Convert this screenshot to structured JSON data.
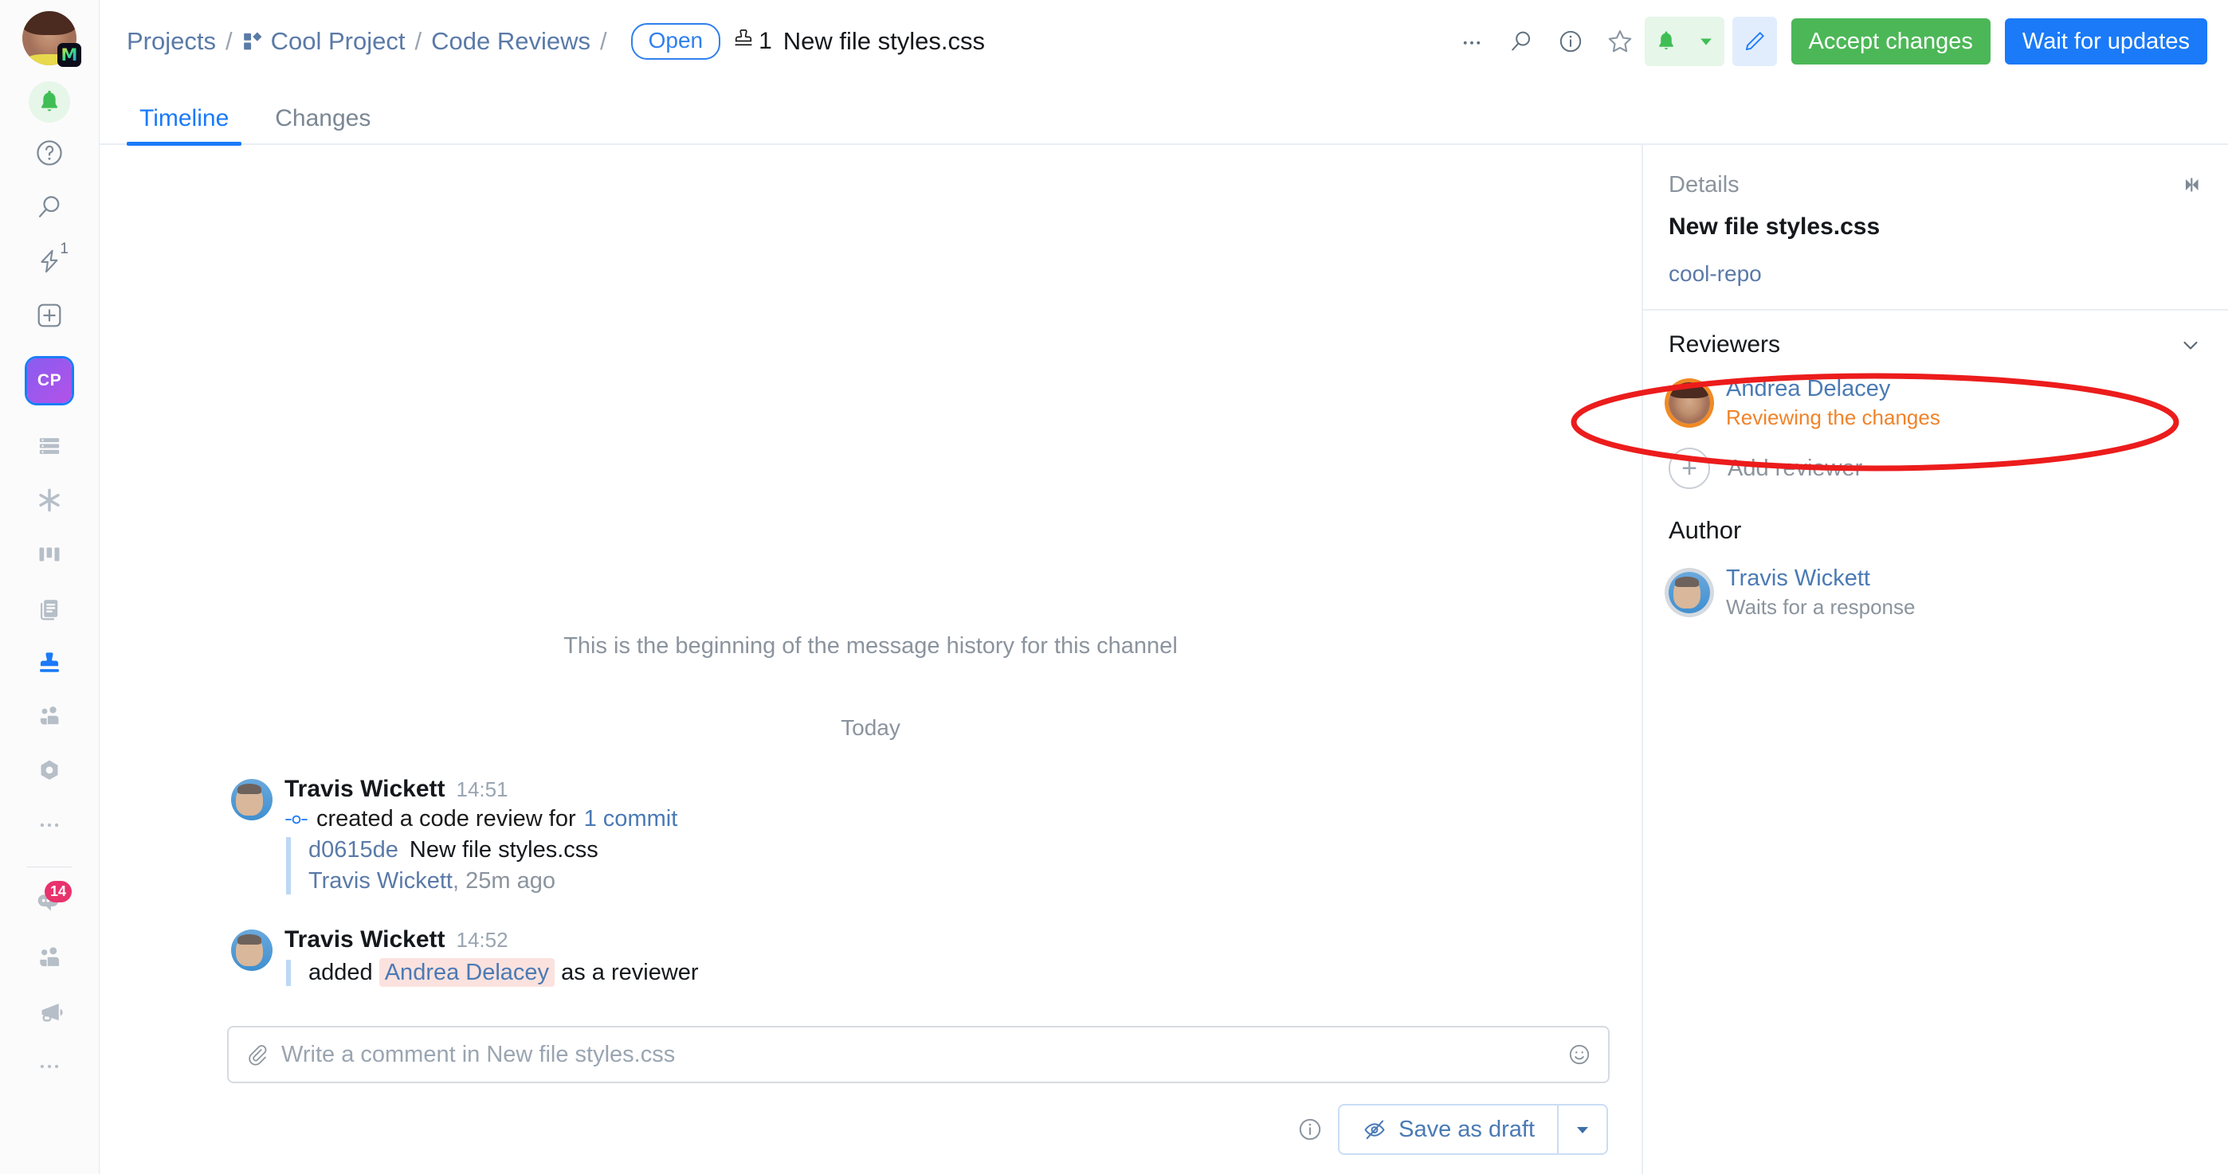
{
  "left_rail": {
    "user_avatar_name": "user-avatar",
    "app_badge_letter": "M",
    "notifications_icon": "bell-icon",
    "help_icon": "question-circle-icon",
    "search_icon": "search-icon",
    "quick_actions_icon": "lightning-icon",
    "quick_actions_count": "1",
    "new_icon": "plus-square-icon",
    "project_badge": "CP",
    "nav_icons": [
      {
        "name": "list-icon",
        "active": false
      },
      {
        "name": "asterisk-icon",
        "active": false
      },
      {
        "name": "board-icon",
        "active": false
      },
      {
        "name": "documents-icon",
        "active": false
      },
      {
        "name": "stamp-icon",
        "active": true
      },
      {
        "name": "people-icon",
        "active": false
      },
      {
        "name": "nut-icon",
        "active": false
      },
      {
        "name": "more-dots-icon",
        "active": false
      }
    ],
    "bottom_icons": [
      {
        "name": "chat-icon",
        "badge": "14"
      },
      {
        "name": "team-icon",
        "badge": ""
      },
      {
        "name": "megaphone-icon",
        "badge": ""
      },
      {
        "name": "more-dots-icon",
        "badge": ""
      }
    ]
  },
  "header": {
    "breadcrumb": [
      {
        "label": "Projects",
        "icon": ""
      },
      {
        "label": "Cool Project",
        "icon": "project-icon"
      },
      {
        "label": "Code Reviews",
        "icon": ""
      }
    ],
    "separator": "/",
    "status_badge": "Open",
    "stamp_icon": "stamp-icon",
    "stamp_count": "1",
    "title": "New file styles.css",
    "actions": {
      "more_icon": "more-dots-icon",
      "search_icon": "search-icon",
      "info_icon": "info-circle-icon",
      "star_icon": "star-icon",
      "bell_icon": "bell-icon",
      "bell_caret_icon": "chevron-down-icon",
      "edit_icon": "pencil-icon",
      "accept_label": "Accept changes",
      "wait_label": "Wait for updates"
    },
    "colors": {
      "accept_green": "#4cb757",
      "wait_blue": "#1a7af8",
      "open_badge_blue": "#2f80ed"
    }
  },
  "tabs": [
    {
      "label": "Timeline",
      "active": true
    },
    {
      "label": "Changes",
      "active": false
    }
  ],
  "timeline": {
    "beginning_notice": "This is the beginning of the message history for this channel",
    "day_separator": "Today",
    "messages": [
      {
        "author": "Travis Wickett",
        "time": "14:51",
        "icon": "commit-icon",
        "action_prefix": "created a code review for",
        "action_link": "1 commit",
        "quote": {
          "sha": "d0615de",
          "title": "New file styles.css",
          "author": "Travis Wickett",
          "ago": ", 25m ago"
        }
      },
      {
        "author": "Travis Wickett",
        "time": "14:52",
        "action_prefix": "added",
        "mention": "Andrea Delacey",
        "action_suffix": "as a reviewer"
      }
    ]
  },
  "composer": {
    "attach_icon": "paperclip-icon",
    "placeholder": "Write a comment in New file styles.css",
    "emoji_icon": "emoji-icon",
    "info_icon": "info-circle-icon",
    "draft_label": "Save as draft",
    "draft_icon": "eye-off-icon",
    "draft_caret_icon": "chevron-down-icon"
  },
  "details": {
    "panel_title": "Details",
    "collapse_icon": "collapse-panel-icon",
    "file_title": "New file styles.css",
    "repo": "cool-repo",
    "reviewers_title": "Reviewers",
    "reviewers_chevron_icon": "chevron-down-icon",
    "reviewers": [
      {
        "name": "Andrea Delacey",
        "status": "Reviewing the changes",
        "status_color": "#f0832a",
        "avatar_ring": "#f08a24"
      }
    ],
    "add_reviewer_label": "Add reviewer",
    "add_reviewer_icon": "plus-circle-icon",
    "author_title": "Author",
    "author": {
      "name": "Travis Wickett",
      "status": "Waits for a response"
    }
  },
  "annotation": {
    "shape": "ellipse",
    "color": "#ec1c1c",
    "target": "Andrea Delacey reviewer row"
  }
}
